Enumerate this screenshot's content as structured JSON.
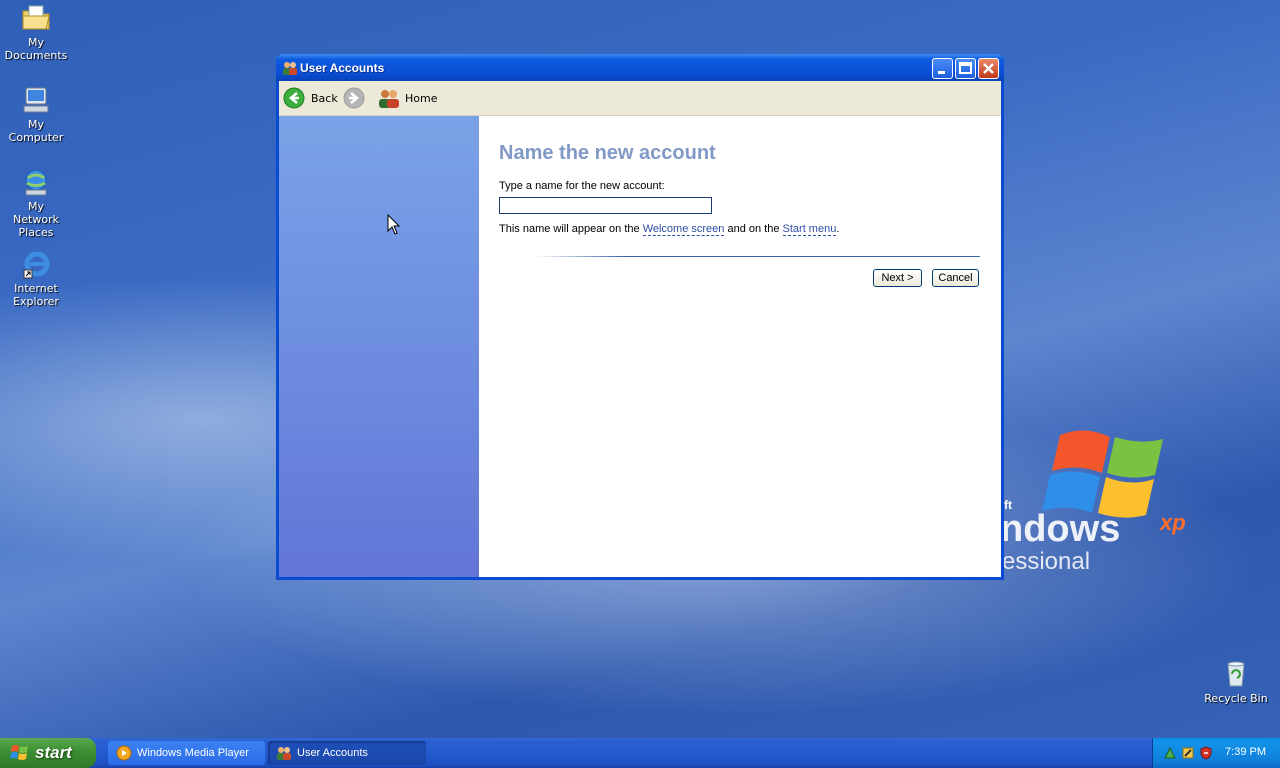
{
  "desktop": {
    "icons": [
      {
        "label": "My Documents"
      },
      {
        "label": "My Computer"
      },
      {
        "label": "My Network Places"
      },
      {
        "label": "Internet Explorer"
      },
      {
        "label": "Recycle Bin"
      }
    ],
    "wallpaper": {
      "small": "ft",
      "word": "ndows",
      "sup": "xp",
      "sub": "essional"
    }
  },
  "window": {
    "title": "User Accounts",
    "toolbar": {
      "back_label": "Back",
      "home_label": "Home"
    },
    "main": {
      "heading": "Name the new account",
      "prompt": "Type a name for the new account:",
      "name_value": "",
      "info_before": "This name will appear on the ",
      "info_link1": "Welcome screen",
      "info_middle": " and on the ",
      "info_link2": "Start menu",
      "info_after": ".",
      "next_label": "Next >",
      "cancel_label": "Cancel"
    }
  },
  "taskbar": {
    "start_label": "start",
    "tasks": [
      {
        "label": "Windows Media Player",
        "active": false
      },
      {
        "label": "User Accounts",
        "active": true
      }
    ],
    "clock": "7:39 PM"
  },
  "colors": {
    "title_bar": "#0a4fd5",
    "heading": "#8199c6",
    "link": "#2f4fa3",
    "start_green": "#3c8f34"
  }
}
